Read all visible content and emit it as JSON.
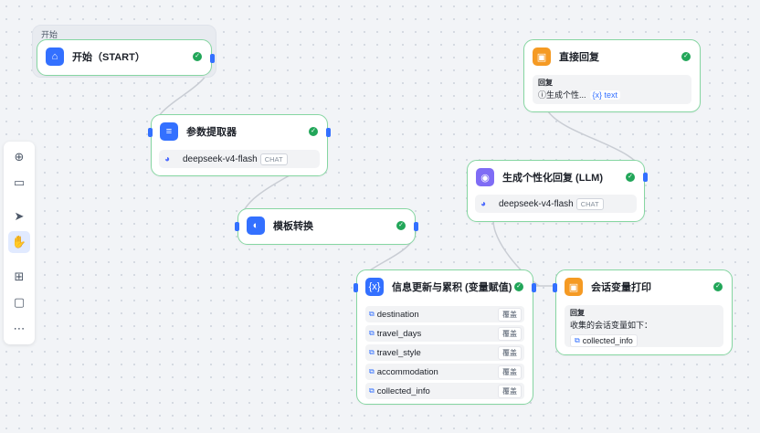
{
  "start_group": {
    "label": "开始"
  },
  "nodes": {
    "start": {
      "title": "开始（START）",
      "icon": "home-icon"
    },
    "param_extractor": {
      "title": "参数提取器",
      "icon": "list-icon",
      "model": "deepseek-v4-flash",
      "model_tag": "CHAT"
    },
    "template": {
      "title": "模板转换",
      "icon": "template-icon"
    },
    "direct_reply": {
      "title": "直接回复",
      "icon": "reply-icon",
      "reply_label": "回复",
      "reply_text": "ⓘ生成个性...",
      "var_tag": "{x} text"
    },
    "llm": {
      "title": "生成个性化回复 (LLM)",
      "icon": "llm-icon",
      "model": "deepseek-v4-flash",
      "model_tag": "CHAT"
    },
    "updater": {
      "title": "信息更新与累积 (变量赋值)",
      "icon": "variable-icon",
      "variables": [
        {
          "name": "destination",
          "mode": "覆盖"
        },
        {
          "name": "travel_days",
          "mode": "覆盖"
        },
        {
          "name": "travel_style",
          "mode": "覆盖"
        },
        {
          "name": "accommodation",
          "mode": "覆盖"
        },
        {
          "name": "collected_info",
          "mode": "覆盖"
        }
      ]
    },
    "session_print": {
      "title": "会话变量打印",
      "icon": "reply-icon",
      "reply_label": "回复",
      "reply_text": "收集的会话变量如下：",
      "var_name": "collected_info"
    }
  },
  "toolbar": {
    "tools": [
      {
        "name": "add-node-icon",
        "active": false
      },
      {
        "name": "add-note-icon",
        "active": false
      },
      {
        "name": "pointer-icon",
        "active": false
      },
      {
        "name": "hand-icon",
        "active": true
      },
      {
        "name": "organize-icon",
        "active": false
      },
      {
        "name": "minimap-icon",
        "active": false
      },
      {
        "name": "more-icon",
        "active": false
      }
    ]
  },
  "colors": {
    "accent": "#3370ff",
    "success": "#22a659",
    "node_border": "#86d6a2",
    "edge": "#c9cdd4"
  }
}
